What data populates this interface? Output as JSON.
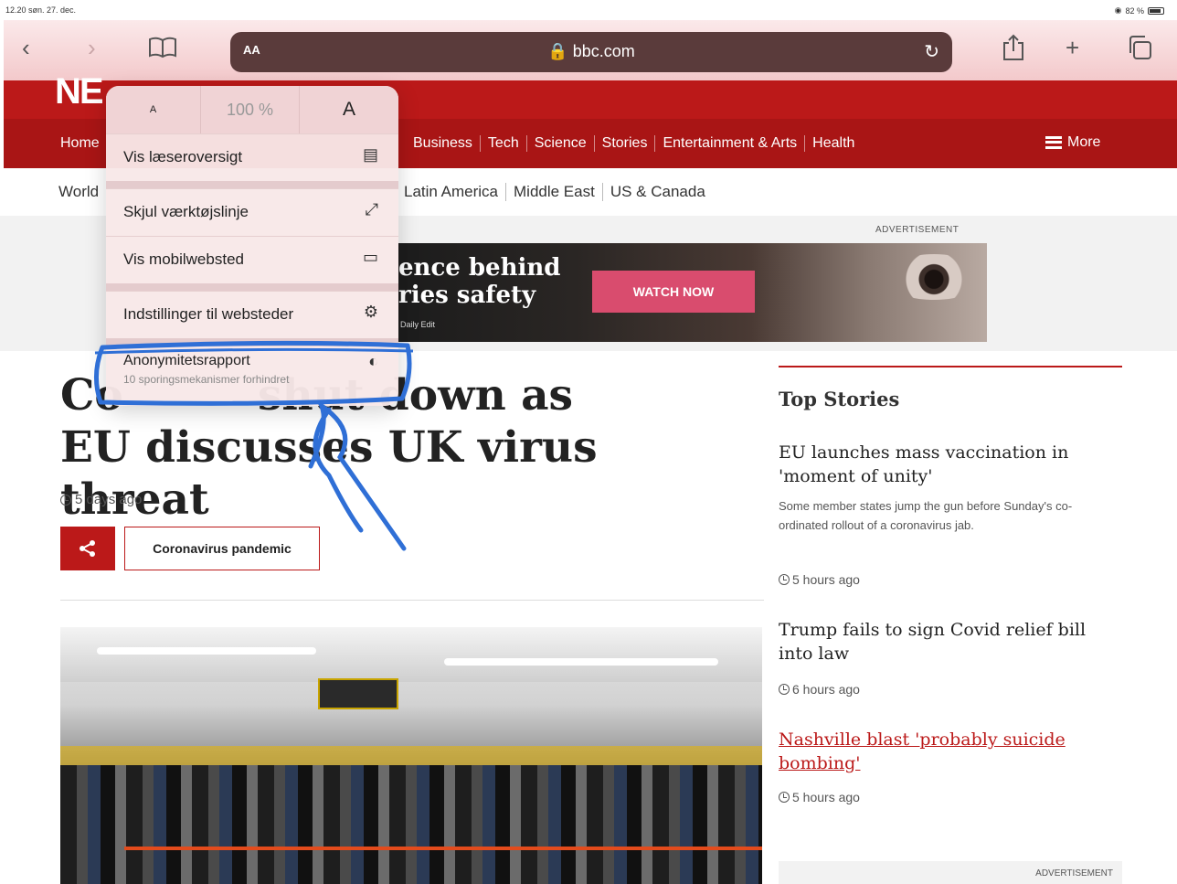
{
  "status_bar": {
    "time_date": "12.20 søn. 27. dec.",
    "battery": "82 %"
  },
  "toolbar": {
    "back_icon": "chevron-left-icon",
    "forward_icon": "chevron-right-icon",
    "bookmarks_icon": "book-icon",
    "text_size_label": "AA",
    "url": "bbc.com",
    "reload_icon": "reload-icon",
    "share_icon": "share-icon",
    "new_tab_icon": "plus-icon",
    "tabs_icon": "tabs-icon"
  },
  "site": {
    "logo_fragment": "NE",
    "nav": {
      "home": "Home",
      "items": [
        "Business",
        "Tech",
        "Science",
        "Stories",
        "Entertainment & Arts",
        "Health"
      ],
      "more": "More"
    },
    "subnav": {
      "world": "World",
      "items": [
        "Latin America",
        "Middle East",
        "US & Canada"
      ]
    },
    "ad": {
      "label": "ADVERTISEMENT",
      "line1": "ence behind",
      "line2": "ries safety",
      "line3": "Daily Edit",
      "cta": "WATCH NOW"
    },
    "article": {
      "headline_line1": "Co         shut down as",
      "headline_line2": "EU discusses UK virus threat",
      "timestamp": "5 days ago",
      "tag": "Coronavirus pandemic"
    },
    "sidebar": {
      "title": "Top Stories",
      "stories": [
        {
          "headline": "EU launches mass vaccination in 'moment of unity'",
          "summary": "Some member states jump the gun before Sunday's co-ordinated rollout of a coronavirus jab.",
          "time": "5 hours ago"
        },
        {
          "headline": "Trump fails to sign Covid relief bill into law",
          "time": "6 hours ago"
        },
        {
          "headline": "Nashville blast 'probably suicide bombing'",
          "time": "5 hours ago"
        }
      ],
      "ad_label": "ADVERTISEMENT"
    }
  },
  "popover": {
    "zoom_small": "A",
    "zoom_percent": "100 %",
    "zoom_large": "A",
    "items": [
      {
        "label": "Vis læseroversigt",
        "icon": "reader-icon"
      },
      {
        "label": "Skjul værktøjslinje",
        "icon": "collapse-icon"
      },
      {
        "label": "Vis mobilwebsted",
        "icon": "mobile-site-icon"
      },
      {
        "label": "Indstillinger til websteder",
        "icon": "settings-icon"
      }
    ],
    "privacy": {
      "label": "Anonymitetsrapport",
      "sub": "10 sporingsmekanismer forhindret",
      "icon": "privacy-shield-icon"
    }
  },
  "colors": {
    "bbc_red": "#bb1919",
    "annotation_blue": "#2f6fd6"
  }
}
